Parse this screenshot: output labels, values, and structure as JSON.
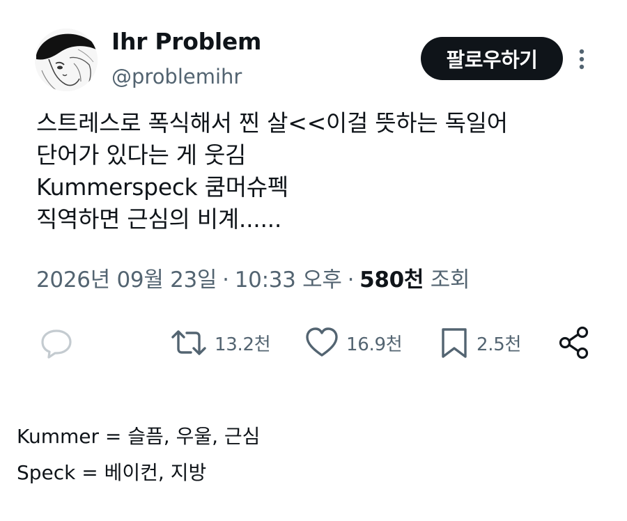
{
  "author": {
    "display_name": "Ihr Problem",
    "handle": "@problemihr",
    "avatar_icon": "anime-girl-avatar"
  },
  "follow_button_label": "팔로우하기",
  "more_icon": "more-vertical-icon",
  "tweet": {
    "lines": [
      "스트레스로 폭식해서 찐 살<<이걸 뜻하는 독일어",
      "단어가 있다는 게 웃김",
      "Kummerspeck 쿰머슈펙",
      "직역하면 근심의 비계......"
    ]
  },
  "meta": {
    "date": "2026년 09월 23일",
    "time": "10:33 오후",
    "views_count": "580천",
    "views_label": "조회"
  },
  "actions": {
    "reply_icon": "reply-icon",
    "retweet_count": "13.2천",
    "like_count": "16.9천",
    "bookmark_count": "2.5천",
    "share_icon": "share-icon"
  },
  "footnotes": [
    "Kummer = 슬픔, 우울, 근심",
    "Speck = 베이컨, 지방"
  ],
  "colors": {
    "text_primary": "#0f1419",
    "text_secondary": "#536471",
    "button_bg": "#0f1419",
    "button_text": "#ffffff"
  }
}
